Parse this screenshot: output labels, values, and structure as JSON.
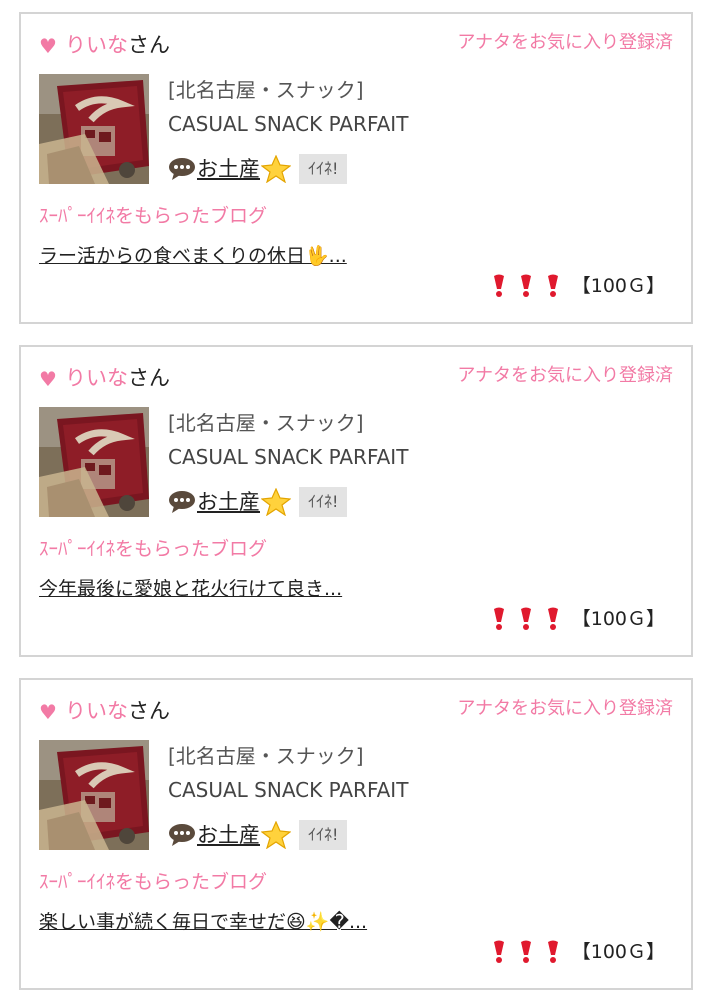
{
  "colors": {
    "pink_accent": "#f27aa5",
    "card_border": "#d4d4d4",
    "button_bg": "#e3e3e3",
    "exclamation_red": "#e0192e"
  },
  "posts": [
    {
      "user": {
        "name": "りいな",
        "suffix": "さん",
        "heart_icon": "heart-icon"
      },
      "fav_status": "アナタをお気に入り登録済",
      "shop": {
        "area": "[北名古屋・スナック]",
        "name": "CASUAL SNACK PARFAIT"
      },
      "gift": {
        "icon": "speech-bubble-icon",
        "label": "お土産",
        "star_icon": "star-icon"
      },
      "iine_label": "ｲｲﾈ!",
      "super_label": "ｽｰﾊﾟｰｲｲﾈをもらったブログ",
      "blog_title": "ラー活からの食べまくりの休日🖖...",
      "reward": {
        "icons": [
          "red-exclamation-icon",
          "red-exclamation-icon",
          "red-exclamation-icon"
        ],
        "text": "【100Ｇ】"
      }
    },
    {
      "user": {
        "name": "りいな",
        "suffix": "さん",
        "heart_icon": "heart-icon"
      },
      "fav_status": "アナタをお気に入り登録済",
      "shop": {
        "area": "[北名古屋・スナック]",
        "name": "CASUAL SNACK PARFAIT"
      },
      "gift": {
        "icon": "speech-bubble-icon",
        "label": "お土産",
        "star_icon": "star-icon"
      },
      "iine_label": "ｲｲﾈ!",
      "super_label": "ｽｰﾊﾟｰｲｲﾈをもらったブログ",
      "blog_title": "今年最後に愛娘と花火行けて良き...",
      "reward": {
        "icons": [
          "red-exclamation-icon",
          "red-exclamation-icon",
          "red-exclamation-icon"
        ],
        "text": "【100Ｇ】"
      }
    },
    {
      "user": {
        "name": "りいな",
        "suffix": "さん",
        "heart_icon": "heart-icon"
      },
      "fav_status": "アナタをお気に入り登録済",
      "shop": {
        "area": "[北名古屋・スナック]",
        "name": "CASUAL SNACK PARFAIT"
      },
      "gift": {
        "icon": "speech-bubble-icon",
        "label": "お土産",
        "star_icon": "star-icon"
      },
      "iine_label": "ｲｲﾈ!",
      "super_label": "ｽｰﾊﾟｰｲｲﾈをもらったブログ",
      "blog_title": "楽しい事が続く毎日で幸せだ😆✨�...",
      "reward": {
        "icons": [
          "red-exclamation-icon",
          "red-exclamation-icon",
          "red-exclamation-icon"
        ],
        "text": "【100Ｇ】"
      }
    }
  ]
}
